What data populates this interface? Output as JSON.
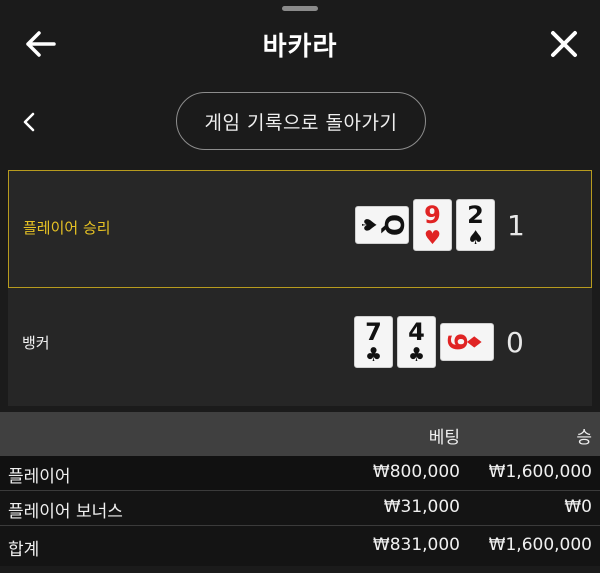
{
  "header": {
    "title": "바카라",
    "back_icon": "arrow-left-icon",
    "close_icon": "close-icon"
  },
  "nav": {
    "back_icon": "chevron-left-icon",
    "history_button_label": "게임 기록으로 돌아가기"
  },
  "result": {
    "player": {
      "label": "플레이어 승리",
      "highlight_color": "#e6c224",
      "cards": [
        {
          "rank": "Q",
          "suit": "♠",
          "color": "black",
          "orientation": "sideways"
        },
        {
          "rank": "9",
          "suit": "♥",
          "color": "red",
          "orientation": "upright"
        },
        {
          "rank": "2",
          "suit": "♠",
          "color": "black",
          "orientation": "upright"
        }
      ],
      "score": "1"
    },
    "banker": {
      "label": "뱅커",
      "cards": [
        {
          "rank": "7",
          "suit": "♣",
          "color": "black",
          "orientation": "upright"
        },
        {
          "rank": "4",
          "suit": "♣",
          "color": "black",
          "orientation": "upright"
        },
        {
          "rank": "9",
          "suit": "♦",
          "color": "red",
          "orientation": "sideways"
        }
      ],
      "score": "0"
    }
  },
  "bets_table": {
    "headers": {
      "bet": "베팅",
      "win": "승"
    },
    "rows": [
      {
        "name": "플레이어",
        "bet": "₩800,000",
        "win": "₩1,600,000"
      },
      {
        "name": "플레이어 보너스",
        "bet": "₩31,000",
        "win": "₩0"
      },
      {
        "name": "합계",
        "bet": "₩831,000",
        "win": "₩1,600,000"
      }
    ]
  }
}
